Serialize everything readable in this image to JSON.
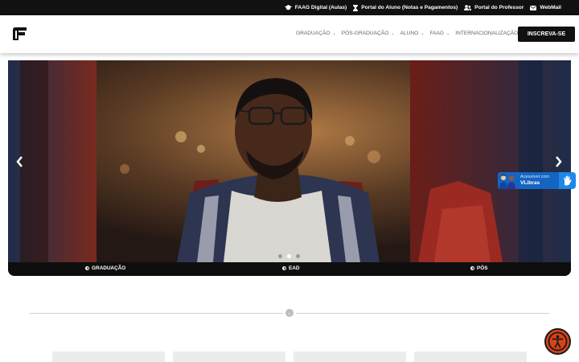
{
  "topbar": {
    "links": [
      {
        "label": "FAAG Digital (Aulas)",
        "icon": "graduation-cap-icon"
      },
      {
        "label": "Portal do Aluno (Notas e Pagamentos)",
        "icon": "hourglass-icon"
      },
      {
        "label": "Portal do Professor",
        "icon": "users-icon"
      },
      {
        "label": "WebMail",
        "icon": "envelope-icon"
      }
    ]
  },
  "header": {
    "logo_icon": "faag-logo",
    "nav": [
      {
        "label": "GRADUAÇÃO",
        "has_dropdown": true
      },
      {
        "label": "PÓS-GRADUAÇÃO",
        "has_dropdown": true
      },
      {
        "label": "ALUNO",
        "has_dropdown": true
      },
      {
        "label": "FAAG",
        "has_dropdown": true
      },
      {
        "label": "INTERNACIONALIZAÇÃO",
        "has_dropdown": false
      }
    ],
    "cta_label": "INSCREVA-SE"
  },
  "slider": {
    "prev_icon": "chevron-left-icon",
    "next_icon": "chevron-right-icon",
    "total_slides": 3,
    "active_slide": 2,
    "tabs": [
      {
        "label": "GRADUAÇÃO",
        "icon": "half-circle-icon"
      },
      {
        "label": "EAD",
        "icon": "half-circle-icon"
      },
      {
        "label": "PÓS",
        "icon": "half-circle-icon"
      }
    ]
  },
  "vlibras": {
    "small": "Acessível com",
    "big": "VLibras"
  },
  "divider_icon": "chevron-down-icon",
  "accessibility_icon": "accessibility-person-icon",
  "colors": {
    "topbar": "#111111",
    "cta": "#111111",
    "vlibras": "#1565c0",
    "accessibility": "#d84315"
  }
}
